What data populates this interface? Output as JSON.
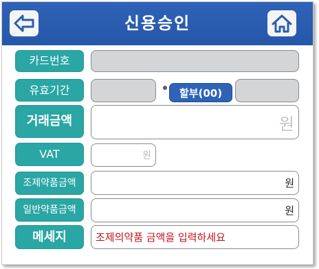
{
  "header": {
    "title": "신용승인",
    "back_icon": "arrow-left-icon",
    "home_icon": "home-icon",
    "color": "#2f63b8"
  },
  "form": {
    "card_number": {
      "label": "카드번호",
      "value": ""
    },
    "expiry": {
      "label": "유효기간",
      "value_left": "",
      "value_right": ""
    },
    "installment": {
      "label": "할부(00)"
    },
    "amount": {
      "label": "거래금액",
      "unit": "원",
      "value": ""
    },
    "vat": {
      "label": "VAT",
      "unit": "원",
      "value": ""
    },
    "compounded_drug": {
      "label": "조제약품금액",
      "unit": "원",
      "value": ""
    },
    "general_drug": {
      "label": "일반약품금액",
      "unit": "원",
      "value": ""
    },
    "message": {
      "label": "메세지",
      "text": "조제의약품 금액을 입력하세요",
      "color": "#c0121a"
    }
  },
  "label_color": "#2aa6a4"
}
